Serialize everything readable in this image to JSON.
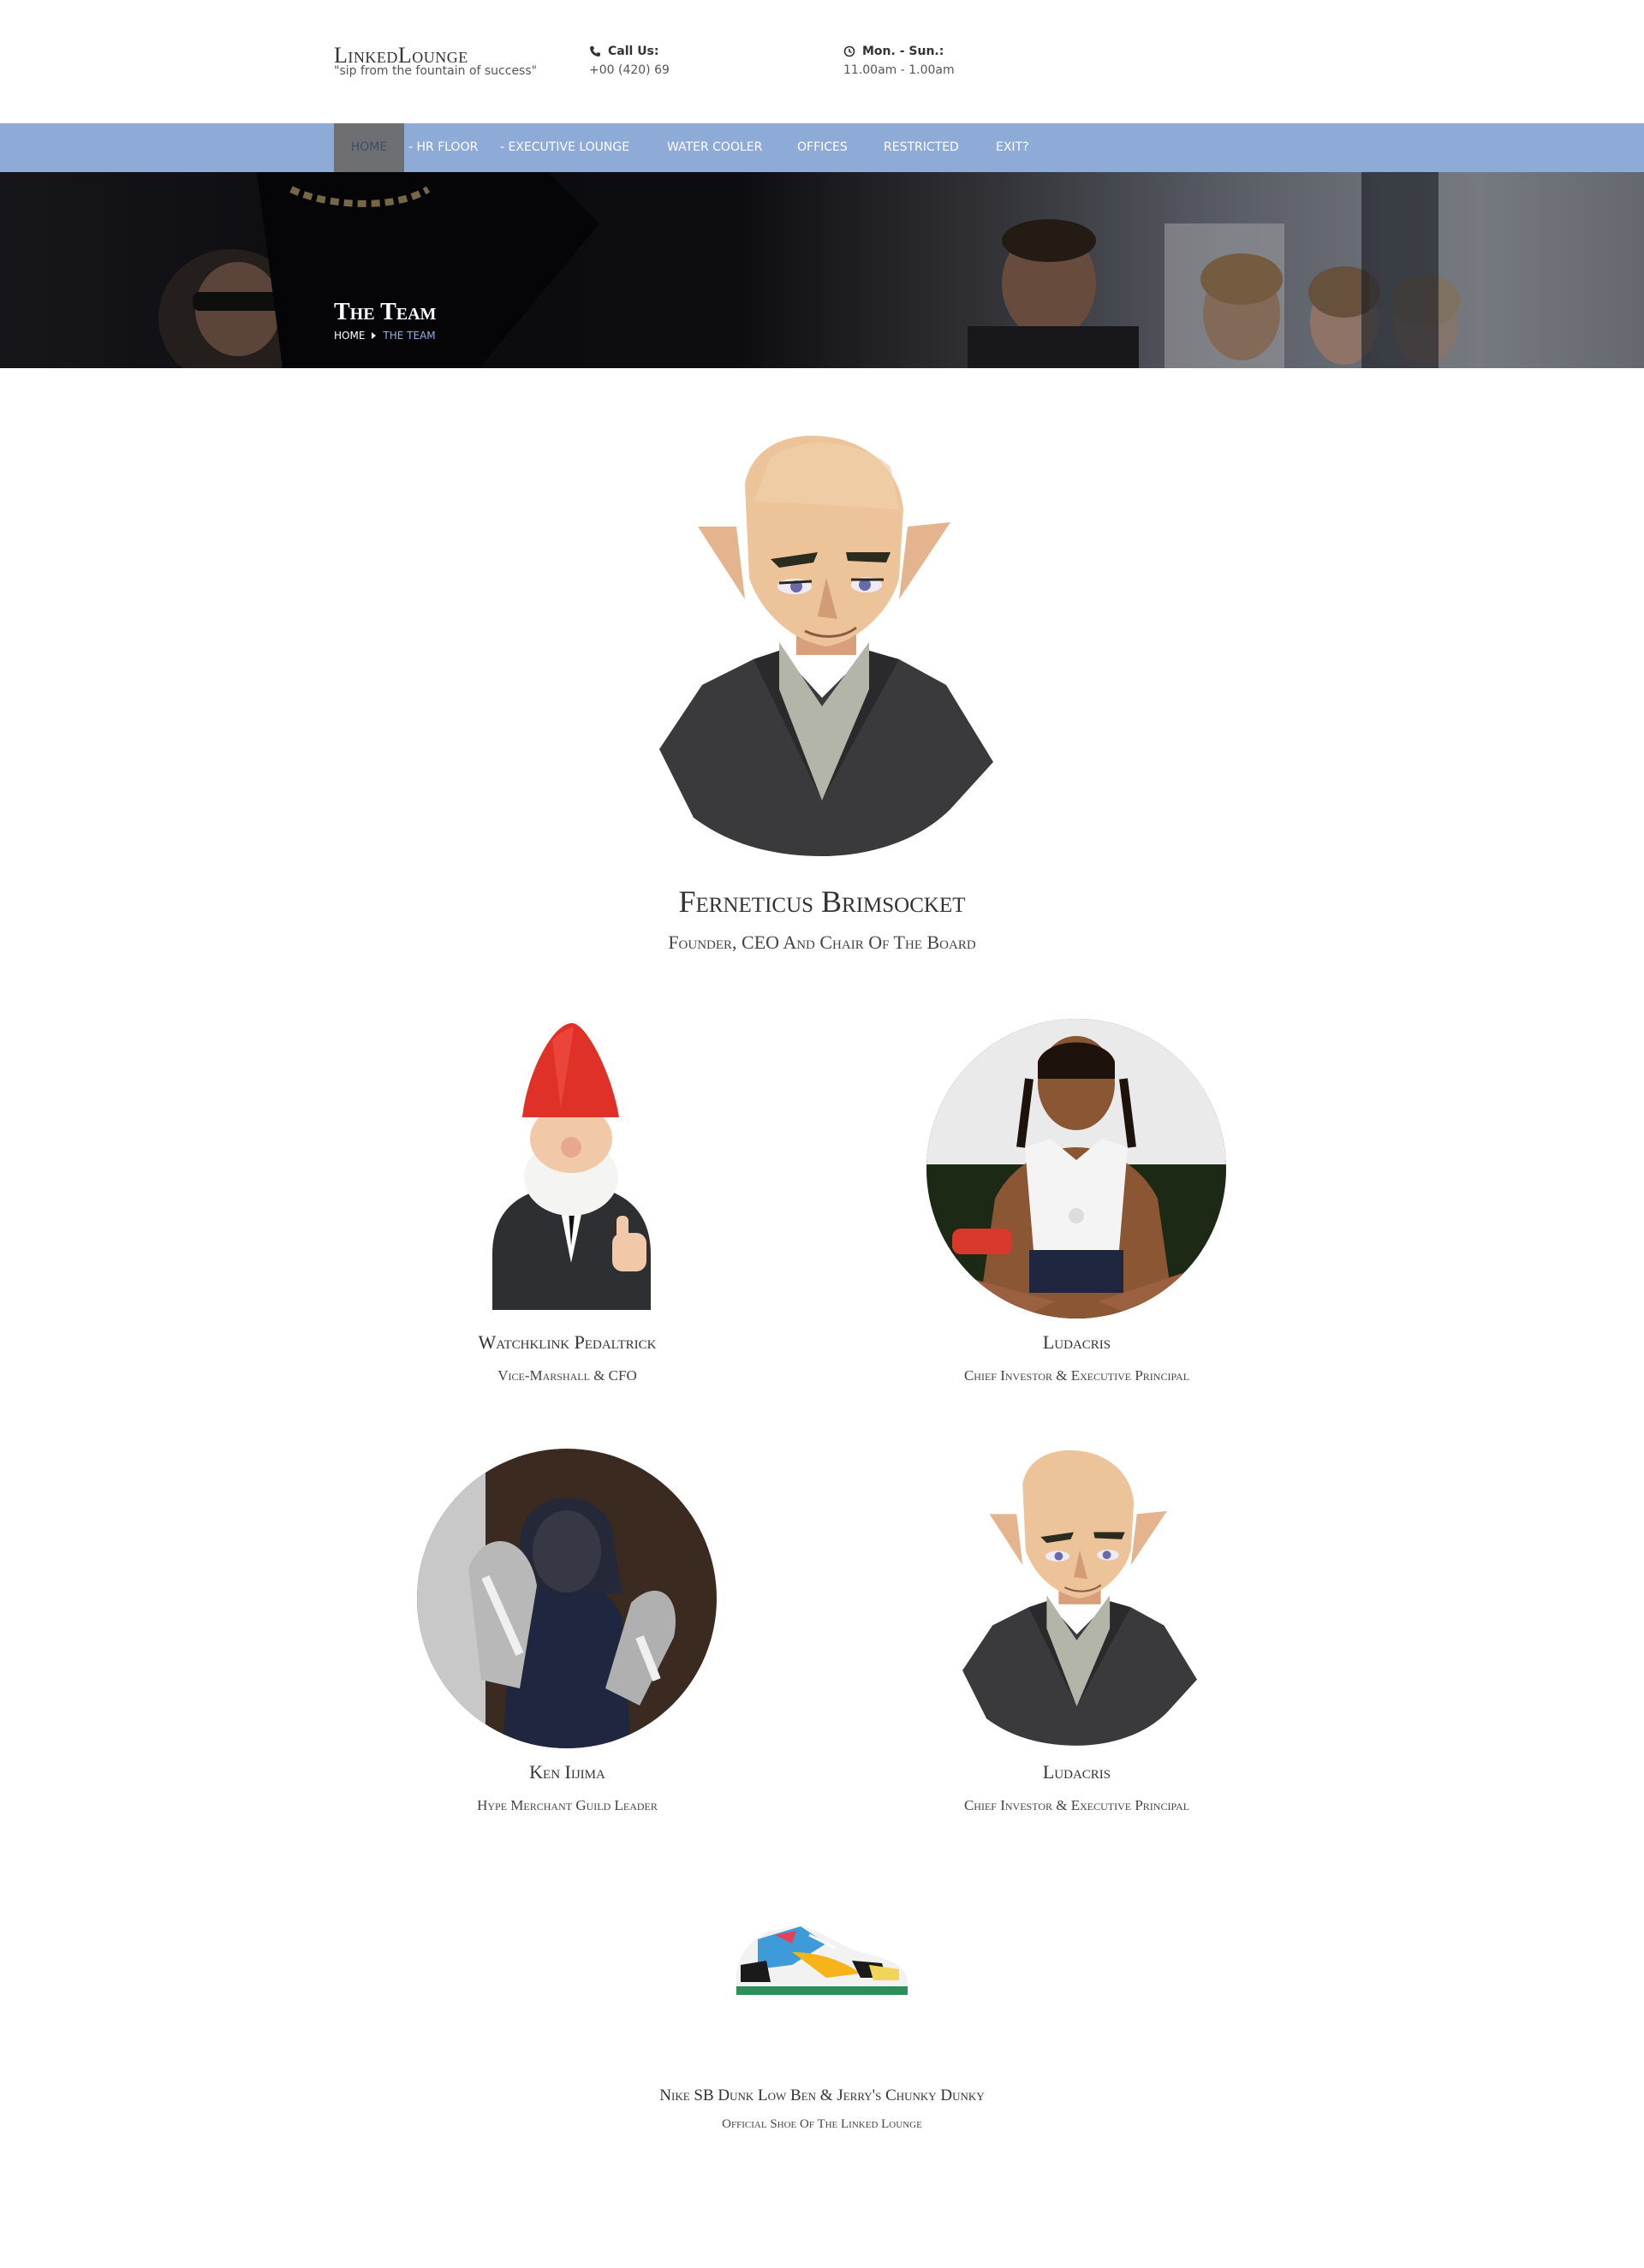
{
  "header": {
    "logo": "LinkedLounge",
    "tagline": "\"sip from the fountain of success\"",
    "contacts": [
      {
        "icon": "phone-icon",
        "label": "Call Us:",
        "value": "+00 (420) 69"
      },
      {
        "icon": "clock-icon",
        "label": "Mon. - Sun.:",
        "value": "11.00am - 1.00am"
      }
    ]
  },
  "nav": {
    "items": [
      {
        "label": "Home",
        "active": true
      },
      {
        "label": "- HR Floor"
      },
      {
        "label": "- Executive Lounge"
      },
      {
        "label": "Water Cooler"
      },
      {
        "label": "Offices"
      },
      {
        "label": "Restricted"
      },
      {
        "label": "Exit?"
      }
    ]
  },
  "banner": {
    "title": "The Team",
    "breadcrumb": {
      "home": "Home",
      "current": "The Team"
    }
  },
  "team": {
    "lead": {
      "name": "Ferneticus Brimsocket",
      "role": "Founder, CEO And Chair Of The Board",
      "image": "elf-avatar"
    },
    "members": [
      {
        "name": "Watchklink Pedaltrick",
        "role": "Vice-Marshall & CFO",
        "image": "gnome-figure"
      },
      {
        "name": "Ludacris",
        "role": "Chief Investor & Executive Principal",
        "image": "ludacris-photo"
      },
      {
        "name": "Ken Iijima",
        "role": "Hype Merchant Guild Leader",
        "image": "sneaker-photo"
      },
      {
        "name": "Ludacris",
        "role": "Chief Investor & Executive Principal",
        "image": "elf-avatar"
      }
    ],
    "footer_item": {
      "name": "Nike SB Dunk Low Ben & Jerry's Chunky Dunky",
      "role": "Official Shoe Of The Linked Lounge",
      "image": "sneaker-product"
    }
  },
  "colors": {
    "nav_bg": "#8eabd7",
    "nav_active": "#6d6f73",
    "crumb_current": "#8fb1e8"
  }
}
